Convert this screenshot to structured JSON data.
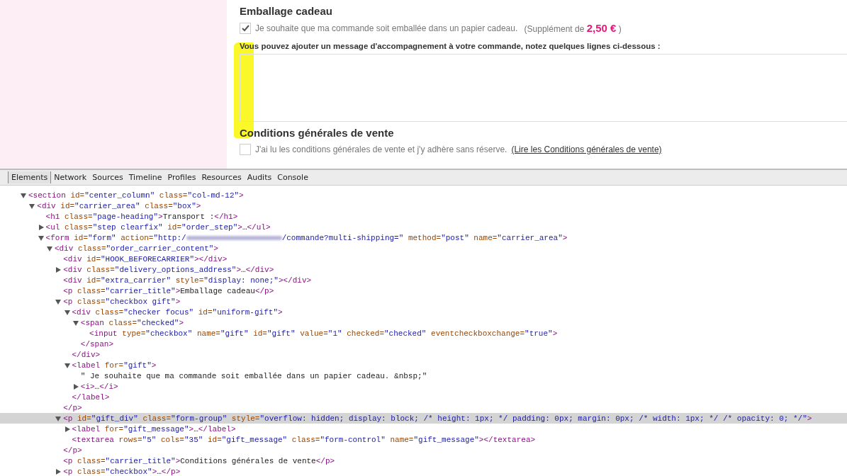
{
  "page": {
    "gift": {
      "title": "Emballage cadeau",
      "checked": true,
      "label": "Je souhaite que ma commande soit emballée dans un papier cadeau.",
      "price_prefix": "(Supplément de",
      "price": "2,50 €",
      "price_suffix": ")",
      "message_label": "Vous pouvez ajouter un message d'accompagnement à votre commande, notez quelques lignes ci-dessous :"
    },
    "terms": {
      "title": "Conditions générales de vente",
      "checked": false,
      "label": "J'ai lu les conditions générales de vente et j'y adhère sans réserve.",
      "link": "(Lire les Conditions générales de vente)"
    }
  },
  "devtools": {
    "tabs": [
      {
        "label": "Elements",
        "selected": true
      },
      {
        "label": "Network",
        "selected": false
      },
      {
        "label": "Sources",
        "selected": false
      },
      {
        "label": "Timeline",
        "selected": false
      },
      {
        "label": "Profiles",
        "selected": false
      },
      {
        "label": "Resources",
        "selected": false
      },
      {
        "label": "Audits",
        "selected": false
      },
      {
        "label": "Console",
        "selected": false
      }
    ],
    "tree": [
      {
        "line": "<section id=\"center_column\" class=\"col-md-12\">",
        "expanded": true,
        "selected": false,
        "children": [
          {
            "line": "<div id=\"carrier_area\" class=\"box\">",
            "expanded": true,
            "selected": false,
            "children": [
              {
                "line": "<h1 class=\"page-heading\">Transport :</h1>",
                "selected": false
              },
              {
                "line": "<ul class=\"step clearfix\" id=\"order_step\">…</ul>",
                "expanded": false,
                "selected": false
              },
              {
                "line": "<form id=\"form\" action=\"http:/",
                "redacted": true,
                "continuation": "/commande?multi-shipping=\" method=\"post\" name=\"carrier_area\">",
                "expanded": true,
                "selected": false,
                "children": [
                  {
                    "line": "<div class=\"order_carrier_content\">",
                    "expanded": true,
                    "selected": false,
                    "children": [
                      {
                        "line": "<div id=\"HOOK_BEFORECARRIER\"></div>",
                        "selected": false
                      },
                      {
                        "line": "<div class=\"delivery_options_address\">…</div>",
                        "expanded": false,
                        "selected": false
                      },
                      {
                        "line": "<div id=\"extra_carrier\" style=\"display: none;\"></div>",
                        "selected": false
                      },
                      {
                        "line": "<p class=\"carrier_title\">Emballage cadeau</p>",
                        "selected": false
                      },
                      {
                        "line": "<p class=\"checkbox gift\">",
                        "expanded": true,
                        "selected": false,
                        "close": "</p>",
                        "children": [
                          {
                            "line": "<div class=\"checker focus\" id=\"uniform-gift\">",
                            "expanded": true,
                            "selected": false,
                            "close": "</div>",
                            "children": [
                              {
                                "line": "<span class=\"checked\">",
                                "expanded": true,
                                "selected": false,
                                "close": "</span>",
                                "children": [
                                  {
                                    "line": "<input type=\"checkbox\" name=\"gift\" id=\"gift\" value=\"1\" checked=\"checked\" eventcheckboxchange=\"true\">",
                                    "selected": false
                                  }
                                ]
                              }
                            ]
                          },
                          {
                            "line": "<label for=\"gift\">",
                            "expanded": true,
                            "selected": false,
                            "close": "</label>",
                            "children": [
                              {
                                "line": "\" Je souhaite que ma commande soit emballée dans un papier cadeau. &nbsp;\"",
                                "selected": false
                              },
                              {
                                "line": "<i>…</i>",
                                "expanded": false,
                                "selected": false
                              }
                            ]
                          }
                        ]
                      },
                      {
                        "line": "<p id=\"gift_div\" class=\"form-group\" style=\"overflow: hidden; display: block; /* height: 1px; */ padding: 0px; margin: 0px; /* width: 1px; */ /* opacity: 0; */\">",
                        "expanded": true,
                        "selected": true,
                        "close": "</p>",
                        "children": [
                          {
                            "line": "<label for=\"gift_message\">…</label>",
                            "expanded": false,
                            "selected": false
                          },
                          {
                            "line": "<textarea rows=\"5\" cols=\"35\" id=\"gift_message\" class=\"form-control\" name=\"gift_message\"></textarea>",
                            "selected": false
                          }
                        ]
                      },
                      {
                        "line": "<p class=\"carrier_title\">Conditions générales de vente</p>",
                        "selected": false
                      },
                      {
                        "line": "<p class=\"checkbox\">…</p>",
                        "expanded": false,
                        "selected": false
                      }
                    ]
                  }
                ]
              }
            ]
          }
        ]
      }
    ]
  }
}
